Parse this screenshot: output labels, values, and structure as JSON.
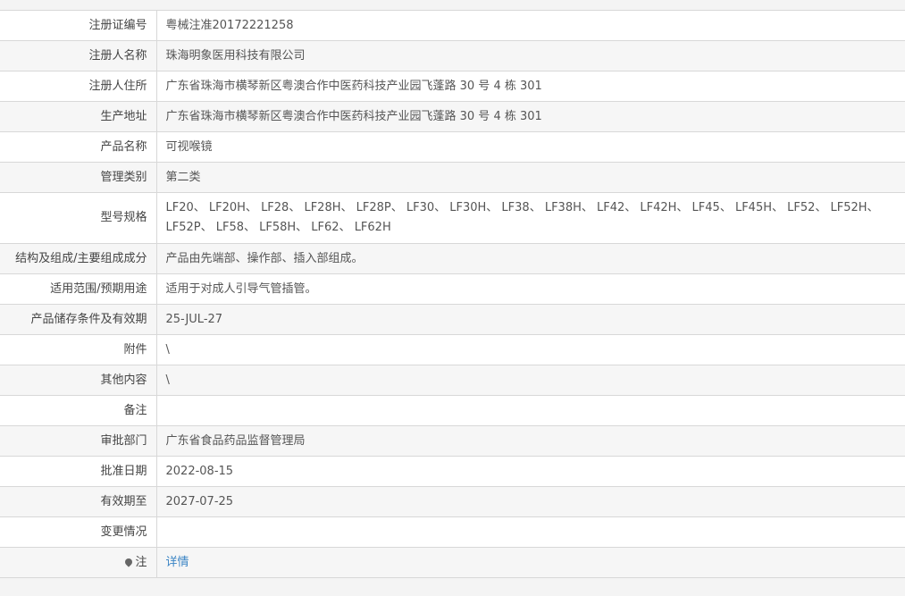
{
  "rows": [
    {
      "label": "注册证编号",
      "value": "粤械注准20172221258"
    },
    {
      "label": "注册人名称",
      "value": "珠海明象医用科技有限公司"
    },
    {
      "label": "注册人住所",
      "value": "广东省珠海市横琴新区粤澳合作中医药科技产业园飞蓬路 30 号 4 栋 301"
    },
    {
      "label": "生产地址",
      "value": "广东省珠海市横琴新区粤澳合作中医药科技产业园飞蓬路 30 号 4 栋 301"
    },
    {
      "label": "产品名称",
      "value": "可视喉镜"
    },
    {
      "label": "管理类别",
      "value": "第二类"
    },
    {
      "label": "型号规格",
      "value": "LF20、 LF20H、 LF28、 LF28H、 LF28P、 LF30、 LF30H、 LF38、 LF38H、 LF42、 LF42H、 LF45、 LF45H、 LF52、 LF52H、 LF52P、 LF58、 LF58H、 LF62、 LF62H"
    },
    {
      "label": "结构及组成/主要组成成分",
      "value": "产品由先端部、操作部、插入部组成。"
    },
    {
      "label": "适用范围/预期用途",
      "value": "适用于对成人引导气管插管。"
    },
    {
      "label": "产品储存条件及有效期",
      "value": "25-JUL-27"
    },
    {
      "label": "附件",
      "value": "\\"
    },
    {
      "label": "其他内容",
      "value": "\\"
    },
    {
      "label": "备注",
      "value": ""
    },
    {
      "label": "审批部门",
      "value": "广东省食品药品监督管理局"
    },
    {
      "label": "批准日期",
      "value": "2022-08-15"
    },
    {
      "label": "有效期至",
      "value": "2027-07-25"
    },
    {
      "label": "变更情况",
      "value": ""
    },
    {
      "label": "注",
      "value": "详情"
    }
  ],
  "colors": {
    "link": "#3a84c4",
    "border": "#d8d8d8",
    "alt_row": "#f6f6f6"
  }
}
